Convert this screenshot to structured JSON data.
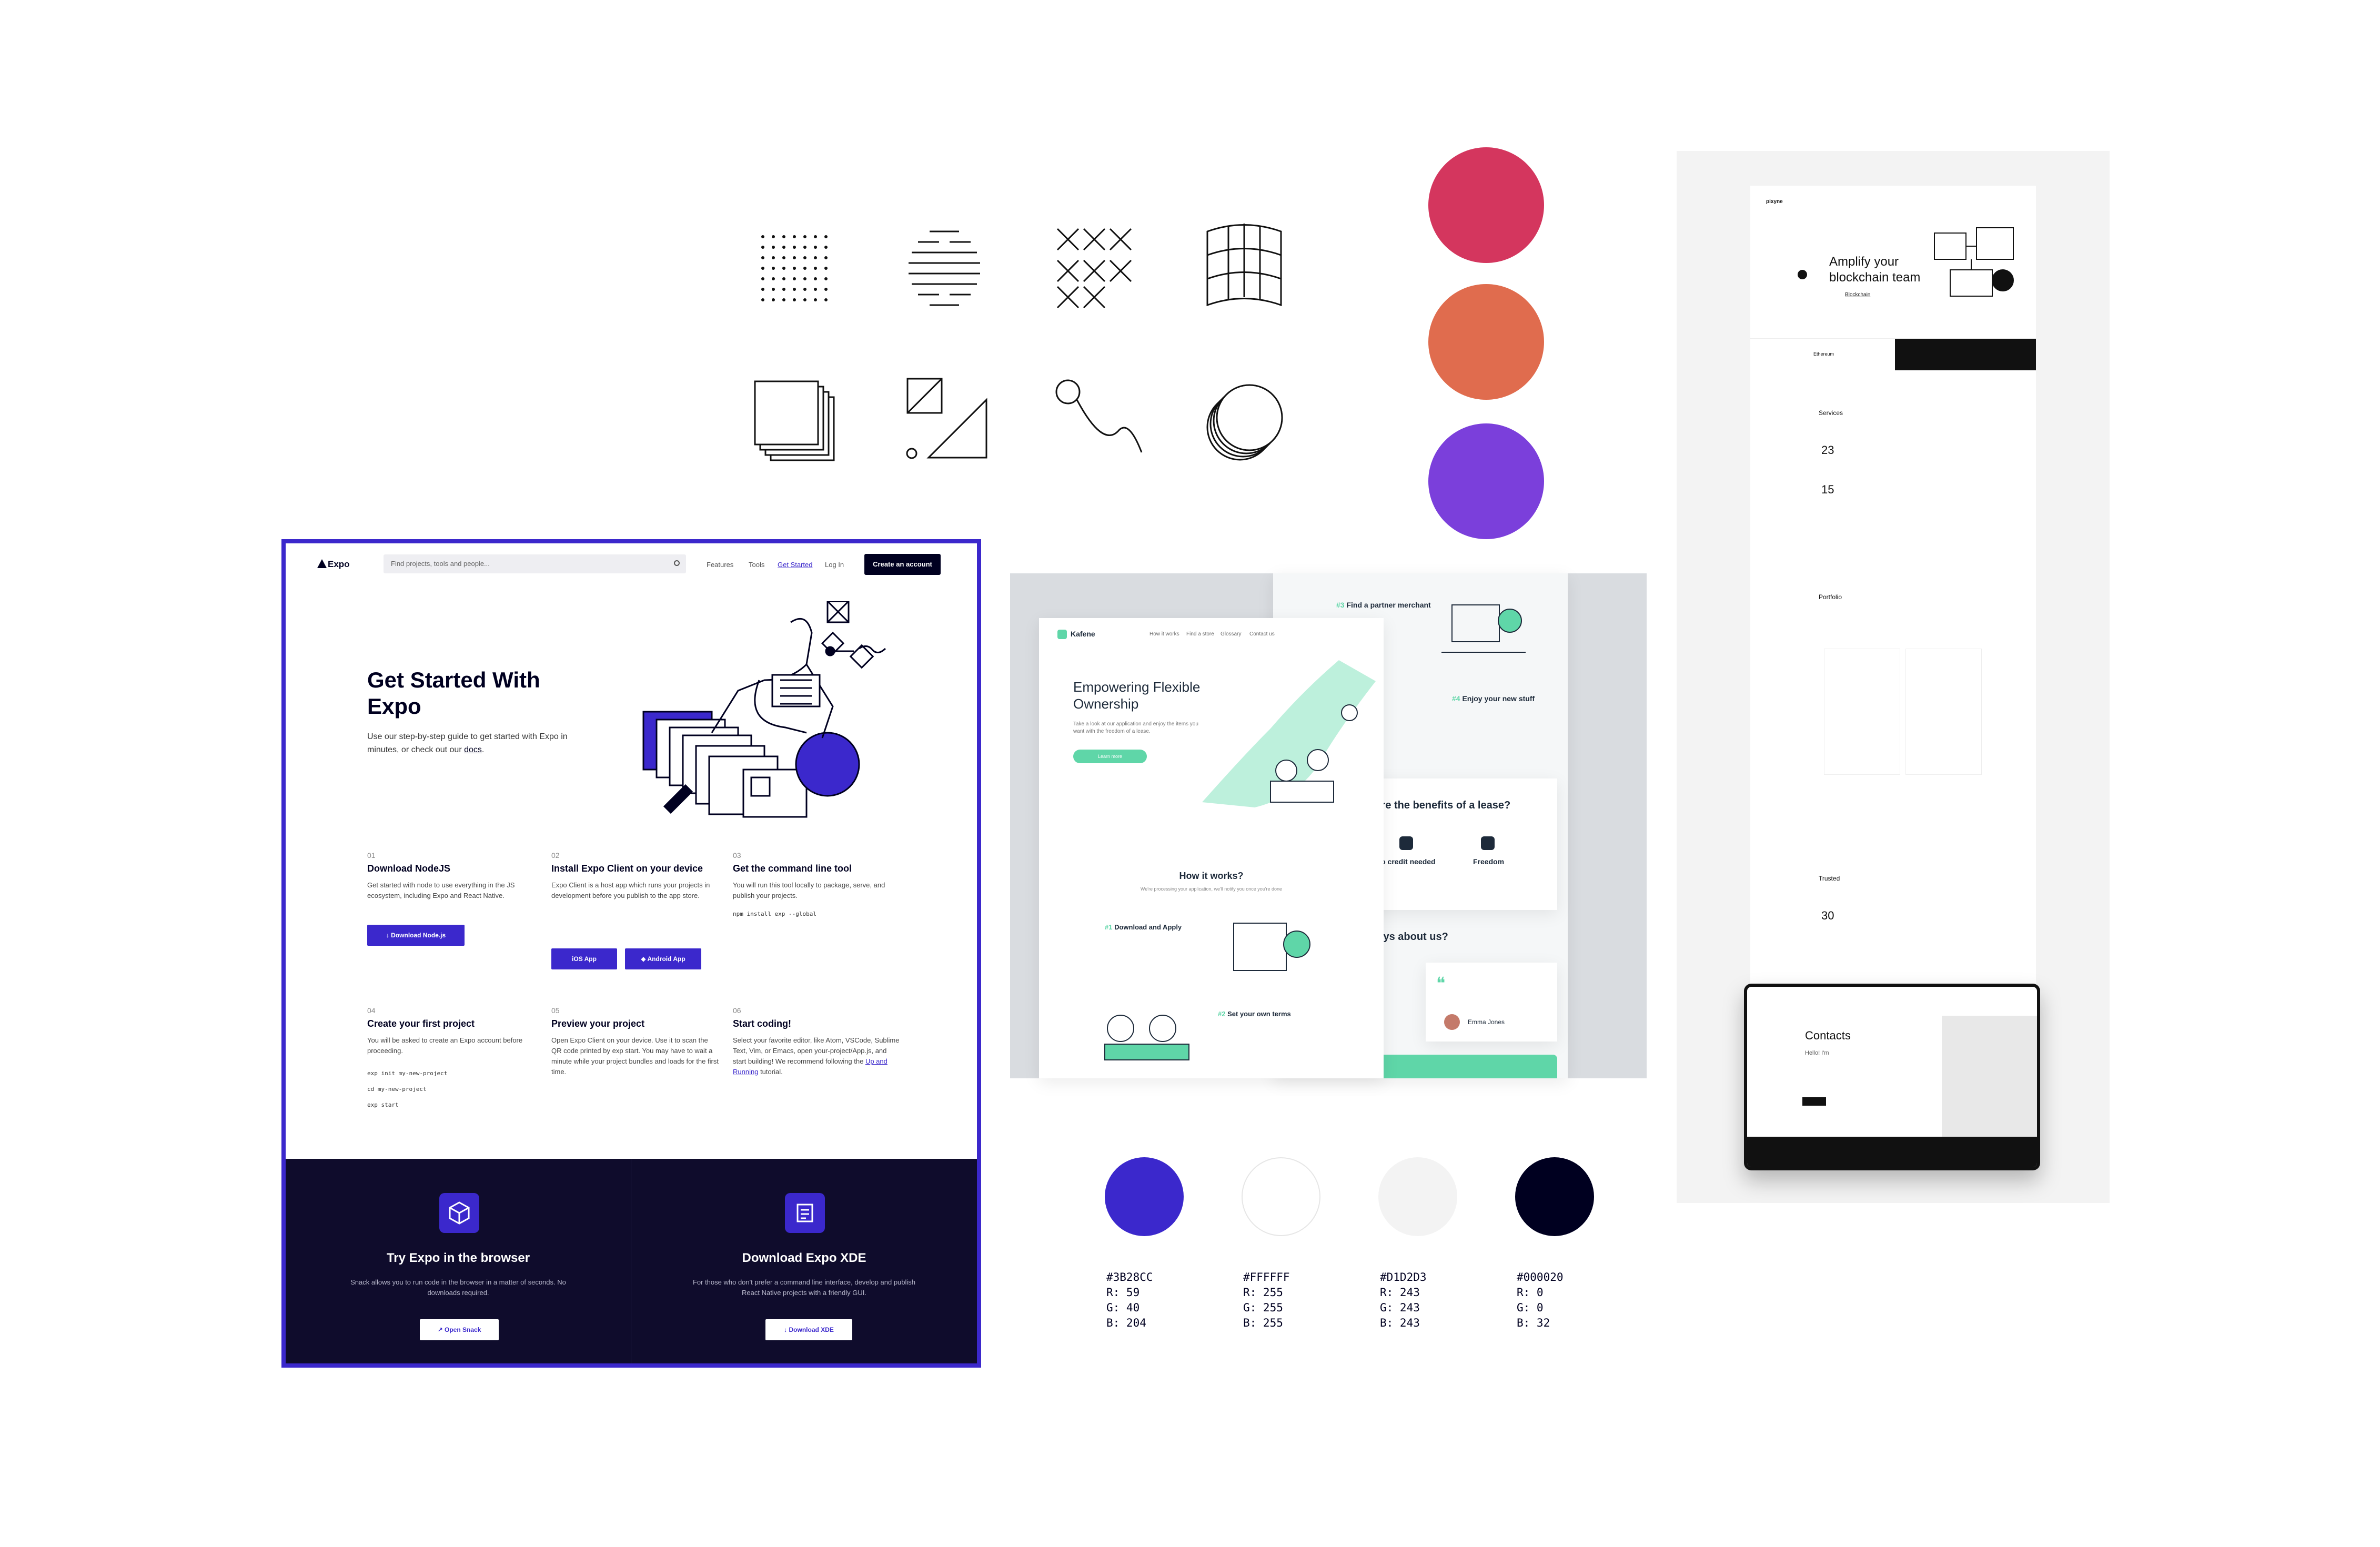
{
  "patterns": [
    "dot-grid-pattern",
    "striped-globe-pattern",
    "x-grid-pattern",
    "curved-grid-pattern",
    "stacked-squares-pattern",
    "triangle-square-pattern",
    "loop-curve-pattern",
    "stacked-circles-pattern"
  ],
  "primary_colors": [
    "#D4365E",
    "#E06C4E",
    "#7B3FDB"
  ],
  "palette": [
    {
      "hex": "#3B28CC",
      "r": "R: 59",
      "g": "G: 40",
      "b": "B: 204"
    },
    {
      "hex": "#FFFFFF",
      "r": "R: 255",
      "g": "G: 255",
      "b": "B: 255"
    },
    {
      "hex": "#D1D2D3",
      "r": "R: 243",
      "g": "G: 243",
      "b": "B: 243"
    },
    {
      "hex": "#000020",
      "r": "R: 0",
      "g": "G: 0",
      "b": "B: 32"
    }
  ],
  "expo": {
    "logo": "Expo",
    "search_placeholder": "Find projects, tools and people...",
    "nav": [
      "Features",
      "Tools",
      "Get Started",
      "Log In"
    ],
    "create_account": "Create an account",
    "hero_title": "Get Started With Expo",
    "hero_sub": "Use our step-by-step guide to get started with Expo in minutes, or check out our",
    "hero_link": "docs",
    "steps": [
      {
        "num": "01",
        "title": "Download NodeJS",
        "desc": "Get started with node to use everything in the JS ecosystem, including Expo and React Native."
      },
      {
        "num": "02",
        "title": "Install Expo Client on your device",
        "desc": "Expo Client is a host app which runs your projects in development before you publish to the app store."
      },
      {
        "num": "03",
        "title": "Get the command line tool",
        "desc": "You will run this tool locally to package, serve, and publish your projects."
      },
      {
        "num": "04",
        "title": "Create your first project",
        "desc": "You will be asked to create an Expo account before proceeding."
      },
      {
        "num": "05",
        "title": "Preview your project",
        "desc": "Open Expo Client on your device. Use it to scan the QR code printed by exp start. You may have to wait a minute while your project bundles and loads for the first time."
      },
      {
        "num": "06",
        "title": "Start coding!",
        "desc": "Select your favorite editor, like Atom, VSCode, Sublime Text, Vim, or Emacs, open your-project/App.js, and start building! We recommend following the",
        "link": "Up and Running",
        "desc_end": "tutorial."
      }
    ],
    "btn_node": "Download Node.js",
    "btn_ios": "iOS App",
    "btn_android": "Android App",
    "cmd_install": "npm install exp --global",
    "cmd_list": [
      "exp init my-new-project",
      "cd my-new-project",
      "exp start"
    ],
    "footer_left": {
      "title": "Try Expo in the browser",
      "desc": "Snack allows you to run code in the browser in a matter of seconds. No downloads required.",
      "button": "Open Snack"
    },
    "footer_right": {
      "title": "Download Expo XDE",
      "desc": "For those who don't prefer a command line interface, develop and publish React Native projects with a friendly GUI.",
      "button": "Download XDE"
    }
  },
  "kafene": {
    "logo": "Kafene",
    "nav": [
      "How it works",
      "Find a store",
      "Glossary",
      "Contact us"
    ],
    "hero_title": "Empowering Flexible Ownership",
    "hero_sub": "Take a look at our application and enjoy the items you want with the freedom of a lease.",
    "hero_btn": "Learn more",
    "how_title": "How it works?",
    "how_sub": "We're processing your application, we'll notify you once you're done",
    "step1": "Download and Apply",
    "step2": "Set your own terms",
    "step3": "Find a partner merchant",
    "step4": "Enjoy your new stuff",
    "benefits_title": "What are the benefits of a lease?",
    "benefit_a": "No credit needed",
    "benefit_b": "Freedom",
    "clients_title": "Clients says about us?",
    "client_name": "Emma Jones",
    "num1": "#1",
    "num2": "#2",
    "num3": "#3",
    "num4": "#4"
  },
  "amplify": {
    "logo": "pixyne",
    "hero_title": "Amplify your blockchain team",
    "hero_tag": "Blockchain",
    "bar_left": "Ethereum",
    "services_label": "Services",
    "stat1": "23",
    "stat2": "15",
    "portfolio_label": "Portfolio",
    "trusted_label": "Trusted",
    "stat3": "30",
    "contacts_title": "Contacts",
    "contacts_hello": "Hello! I'm"
  }
}
